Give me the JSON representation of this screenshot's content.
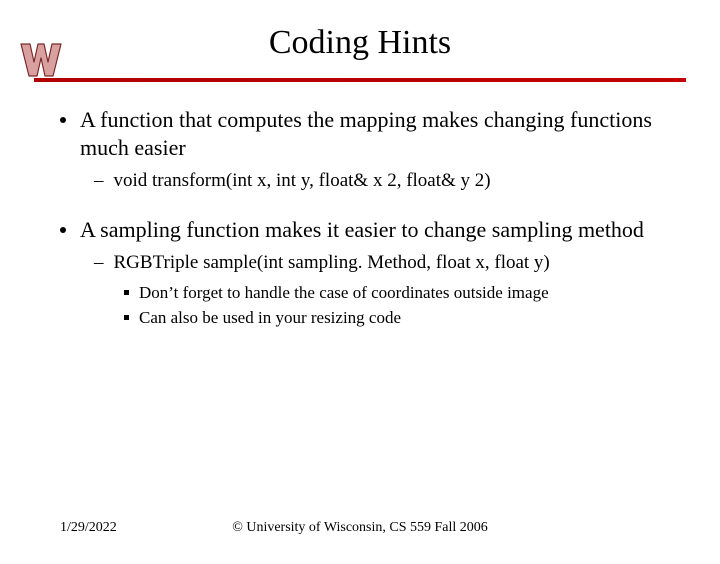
{
  "title": "Coding Hints",
  "bullets": [
    {
      "text": "A function that computes the mapping makes changing functions much easier",
      "sub": [
        {
          "text": "void transform(int x, int y, float& x 2, float& y 2)",
          "sub": []
        }
      ]
    },
    {
      "text": "A sampling function makes it easier to change sampling method",
      "sub": [
        {
          "text": "RGBTriple sample(int sampling. Method, float x, float y)",
          "sub": [
            {
              "text": "Don’t forget to handle the case of coordinates outside image"
            },
            {
              "text": "Can also be used in your resizing code"
            }
          ]
        }
      ]
    }
  ],
  "footer": {
    "date": "1/29/2022",
    "copyright": "© University of Wisconsin, CS 559 Fall 2006"
  },
  "logo_alt": "Wisconsin W logo"
}
